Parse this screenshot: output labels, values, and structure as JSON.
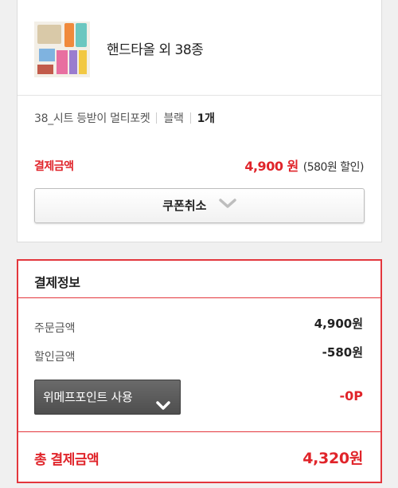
{
  "product": {
    "name": "핸드타올 외 38종",
    "thumbnail_icon": "product-thumbnail-image",
    "option": "38_시트 등받이 멀티포켓",
    "color": "블랙",
    "quantity": "1개"
  },
  "payment": {
    "label": "결제금액",
    "price": "4,900 원",
    "discount": "(580원 할인)"
  },
  "coupon": {
    "cancel_label": "쿠폰취소",
    "chevron_icon": "chevron-down-icon"
  },
  "payment_info": {
    "title": "결제정보",
    "order_amount_label": "주문금액",
    "order_amount_value": "4,900원",
    "discount_amount_label": "할인금액",
    "discount_amount_value": "-580원",
    "point_button_label": "위메프포인트 사용",
    "point_value": "-0P",
    "total_label": "총 결제금액",
    "total_value": "4,320원"
  },
  "colors": {
    "accent": "#e0242a",
    "panel_border": "#e3373d",
    "point_button_bg": "#555555"
  }
}
